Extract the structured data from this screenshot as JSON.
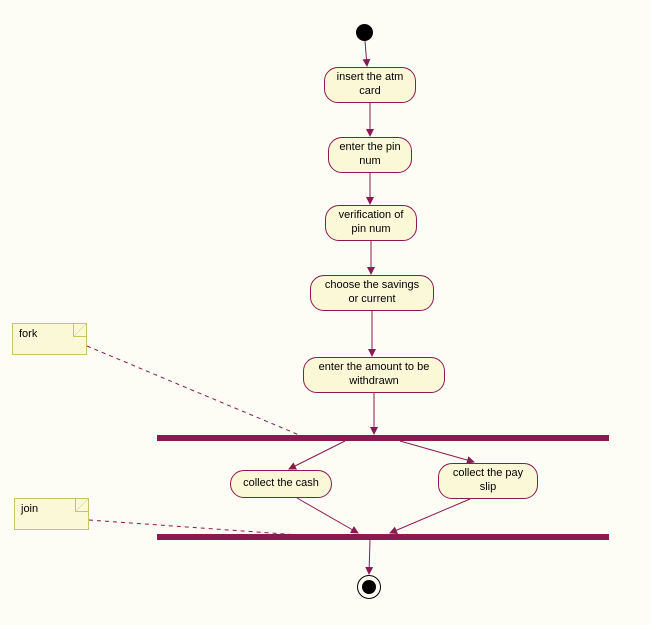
{
  "nodes": {
    "a1": "insert the atm card",
    "a2": "enter the pin num",
    "a3": "verification of pin num",
    "a4": "choose the savings or current",
    "a5": "enter the amount to be withdrawn",
    "a6": "collect the cash",
    "a7": "collect the pay slip"
  },
  "notes": {
    "fork": "fork",
    "join": "join"
  }
}
